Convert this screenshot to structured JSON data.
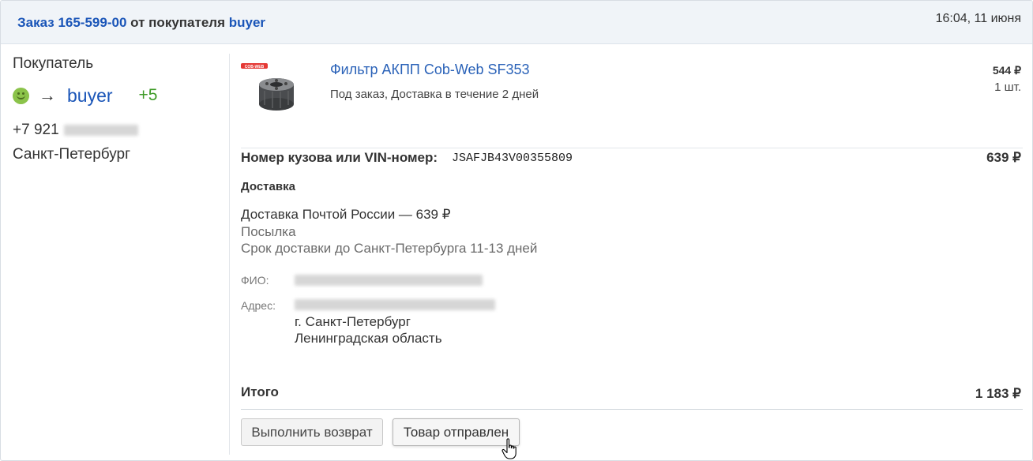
{
  "header": {
    "order_link": "Заказ 165-599-00",
    "from_text": "от покупателя",
    "buyer_link": "buyer",
    "datetime": "16:04, 11 июня"
  },
  "buyer": {
    "heading": "Покупатель",
    "icon": "smiley-icon",
    "arrow": "→",
    "name": "buyer",
    "rating": "+5",
    "phone_prefix": "+7 921",
    "city": "Санкт-Петербург"
  },
  "product": {
    "image_label": "COB-WEB",
    "title": "Фильтр АКПП Cob-Web SF353",
    "status": "Под заказ, Доставка в течение 2 дней",
    "price": "544 ₽",
    "qty": "1 шт."
  },
  "vin": {
    "label": "Номер кузова или VIN-номер:",
    "value": "JSAFJB43V00355809",
    "price": "639 ₽"
  },
  "delivery": {
    "heading": "Доставка",
    "method": "Доставка Почтой России — 639 ₽",
    "type": "Посылка",
    "term": "Срок доставки до Санкт-Петербурга 11-13 дней",
    "fio_label": "ФИО:",
    "address_label": "Адрес:",
    "address_city": "г. Санкт-Петербург",
    "address_region": "Ленинградская область"
  },
  "total": {
    "label": "Итого",
    "value": "1 183 ₽"
  },
  "actions": {
    "return_label": "Выполнить возврат",
    "shipped_label": "Товар отправлен"
  },
  "colors": {
    "link": "#1a55b8",
    "rating": "#3d9a26",
    "header_bg": "#f0f4f8"
  }
}
